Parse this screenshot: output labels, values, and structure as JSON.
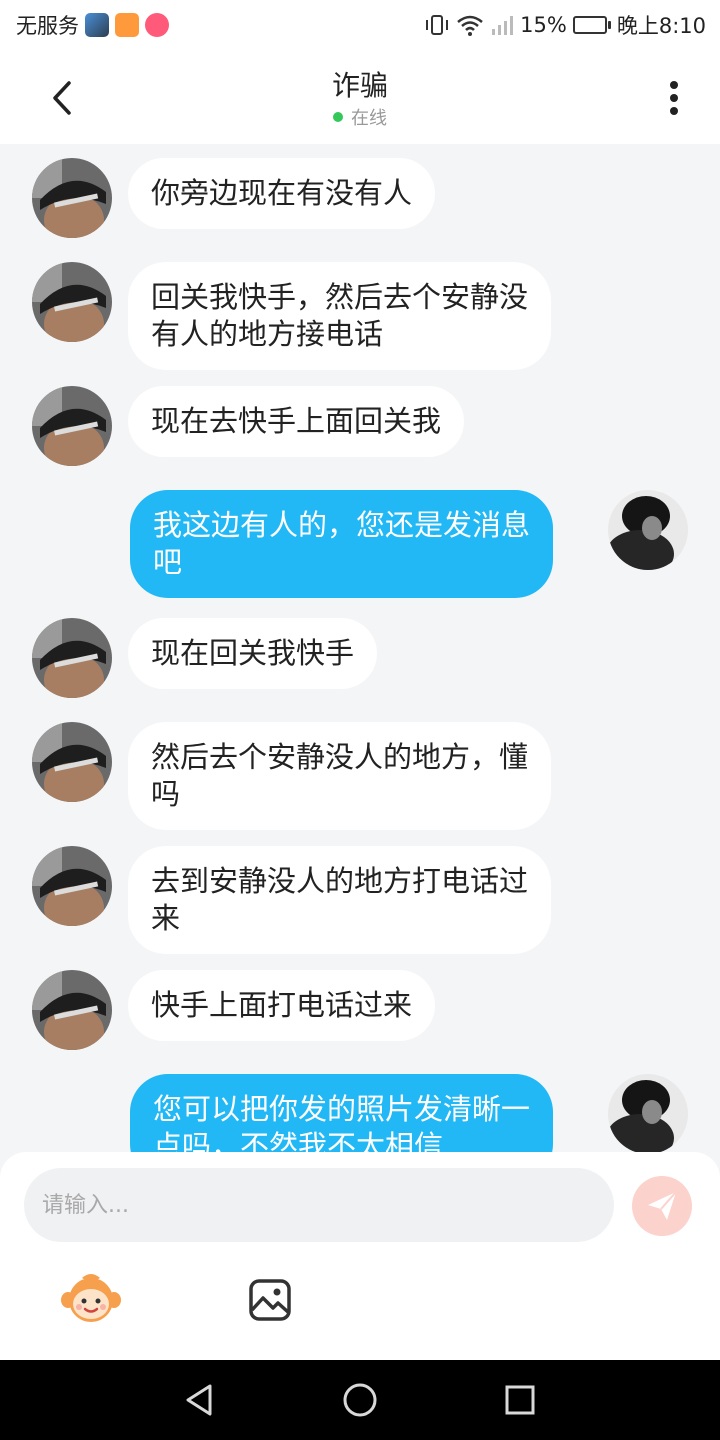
{
  "status_bar": {
    "carrier": "无服务",
    "battery": "15%",
    "battery_level": 0.15,
    "time": "晚上8:10",
    "icons": [
      "gallery-app-icon",
      "video-app-icon",
      "game-app-icon",
      "vibrate-icon",
      "wifi-icon",
      "signal-icon"
    ]
  },
  "header": {
    "title": "诈骗",
    "status": "在线",
    "back_icon": "chevron-left-icon",
    "more_icon": "more-vertical-icon"
  },
  "messages": [
    {
      "side": "in",
      "lines": [
        "你旁边现在有没有人"
      ]
    },
    {
      "side": "in",
      "lines": [
        "回关我快手，然后去个安静没",
        "有人的地方接电话"
      ]
    },
    {
      "side": "in",
      "lines": [
        "现在去快手上面回关我"
      ]
    },
    {
      "side": "out",
      "lines": [
        "我这边有人的，您还是发消息",
        "吧"
      ]
    },
    {
      "side": "in",
      "lines": [
        "现在回关我快手"
      ]
    },
    {
      "side": "in",
      "lines": [
        "然后去个安静没人的地方，懂",
        "吗"
      ]
    },
    {
      "side": "in",
      "lines": [
        "去到安静没人的地方打电话过",
        "来"
      ]
    },
    {
      "side": "in",
      "lines": [
        "快手上面打电话过来"
      ]
    },
    {
      "side": "out",
      "lines": [
        "您可以把你发的照片发清晰一",
        "点吗，不然我不太相信"
      ]
    }
  ],
  "input": {
    "placeholder": "请输入...",
    "value": "",
    "send_icon": "send-icon",
    "emoji_icon": "monkey-emoji-icon",
    "image_icon": "image-icon"
  },
  "nav_bar": {
    "icons": [
      "nav-back-icon",
      "nav-home-icon",
      "nav-recent-icon"
    ]
  },
  "colors": {
    "outgoing_bubble": "#22b8f5",
    "incoming_bubble": "#ffffff",
    "background": "#f4f5f7",
    "online_dot": "#34c759",
    "send_button": "#fcd2cc"
  }
}
